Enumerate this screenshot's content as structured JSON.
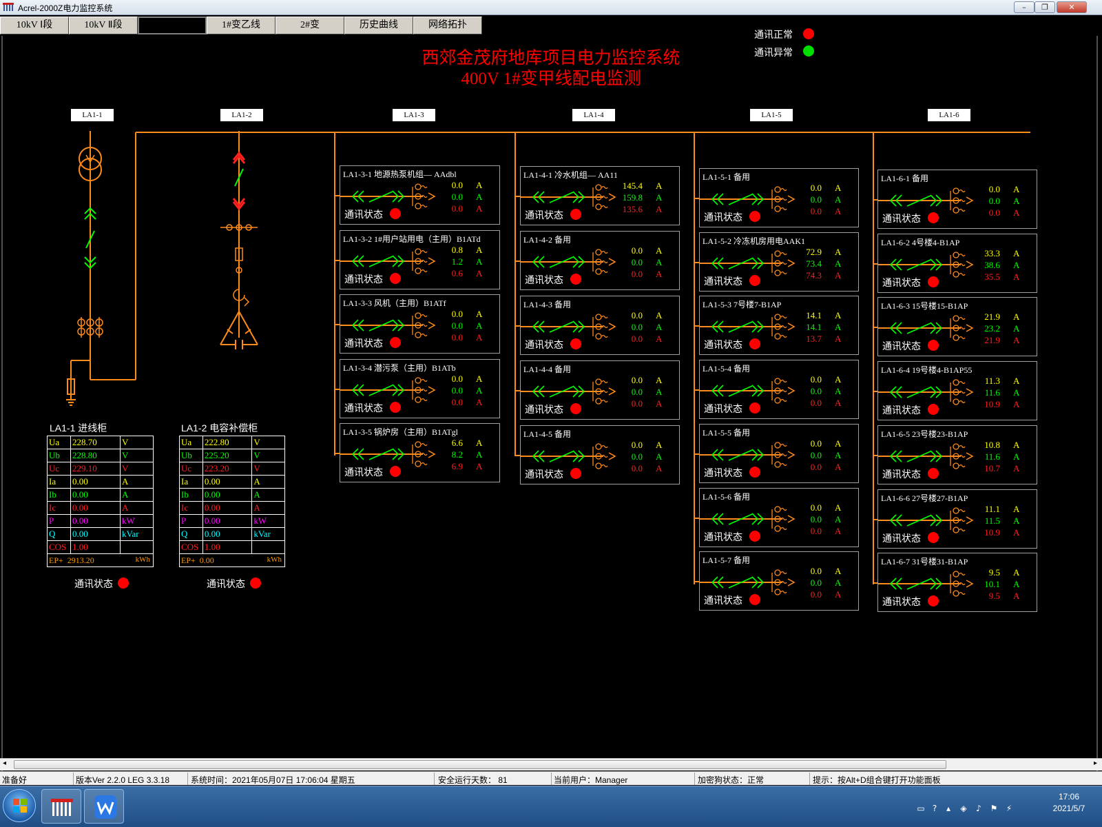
{
  "window": {
    "title": "Acrel-2000Z电力监控系统",
    "min": "–",
    "max": "❐",
    "close": "✕"
  },
  "tabs": [
    "10kV Ⅰ段",
    "10kV Ⅱ段",
    "",
    "1#变乙线",
    "2#变",
    "历史曲线",
    "网络拓扑"
  ],
  "legend": {
    "normal_label": "通讯正常",
    "abnormal_label": "通讯异常",
    "normal_color": "#ff0000",
    "abnormal_color": "#00e000"
  },
  "title": {
    "line1": "西郊金茂府地库项目电力监控系统",
    "line2": "400V 1#变甲线配电监测"
  },
  "bus_labels": [
    "LA1-1",
    "LA1-2",
    "LA1-3",
    "LA1-4",
    "LA1-5",
    "LA1-6"
  ],
  "comm_label": "通讯状态",
  "feeders": [
    [
      {
        "title": "LA1-3-1 地源热泵机组— AAdbl",
        "vals": [
          "0.0",
          "0.0",
          "0.0"
        ],
        "unit": "A"
      },
      {
        "title": "LA1-3-2 1#用户站用电（主用）B1ATd",
        "vals": [
          "0.8",
          "1.2",
          "0.6"
        ],
        "unit": "A"
      },
      {
        "title": "LA1-3-3 风机（主用）B1ATf",
        "vals": [
          "0.0",
          "0.0",
          "0.0"
        ],
        "unit": "A"
      },
      {
        "title": "LA1-3-4 潜污泵（主用）B1ATb",
        "vals": [
          "0.0",
          "0.0",
          "0.0"
        ],
        "unit": "A"
      },
      {
        "title": "LA1-3-5 锅炉房（主用）B1ATgl",
        "vals": [
          "6.6",
          "8.2",
          "6.9"
        ],
        "unit": "A"
      }
    ],
    [
      {
        "title": "LA1-4-1 冷水机组— AA11",
        "vals": [
          "145.4",
          "159.8",
          "135.6"
        ],
        "unit": "A"
      },
      {
        "title": "LA1-4-2 备用",
        "vals": [
          "0.0",
          "0.0",
          "0.0"
        ],
        "unit": "A"
      },
      {
        "title": "LA1-4-3 备用",
        "vals": [
          "0.0",
          "0.0",
          "0.0"
        ],
        "unit": "A"
      },
      {
        "title": "LA1-4-4 备用",
        "vals": [
          "0.0",
          "0.0",
          "0.0"
        ],
        "unit": "A"
      },
      {
        "title": "LA1-4-5 备用",
        "vals": [
          "0.0",
          "0.0",
          "0.0"
        ],
        "unit": "A"
      }
    ],
    [
      {
        "title": "LA1-5-1 备用",
        "vals": [
          "0.0",
          "0.0",
          "0.0"
        ],
        "unit": "A"
      },
      {
        "title": "LA1-5-2 冷冻机房用电AAK1",
        "vals": [
          "72.9",
          "73.4",
          "74.3"
        ],
        "unit": "A"
      },
      {
        "title": "LA1-5-3 7号楼7-B1AP",
        "vals": [
          "14.1",
          "14.1",
          "13.7"
        ],
        "unit": "A"
      },
      {
        "title": "LA1-5-4 备用",
        "vals": [
          "0.0",
          "0.0",
          "0.0"
        ],
        "unit": "A"
      },
      {
        "title": "LA1-5-5 备用",
        "vals": [
          "0.0",
          "0.0",
          "0.0"
        ],
        "unit": "A"
      },
      {
        "title": "LA1-5-6 备用",
        "vals": [
          "0.0",
          "0.0",
          "0.0"
        ],
        "unit": "A"
      },
      {
        "title": "LA1-5-7 备用",
        "vals": [
          "0.0",
          "0.0",
          "0.0"
        ],
        "unit": "A"
      }
    ],
    [
      {
        "title": "LA1-6-1 备用",
        "vals": [
          "0.0",
          "0.0",
          "0.0"
        ],
        "unit": "A"
      },
      {
        "title": "LA1-6-2 4号楼4-B1AP",
        "vals": [
          "33.3",
          "38.6",
          "35.5"
        ],
        "unit": "A"
      },
      {
        "title": "LA1-6-3 15号楼15-B1AP",
        "vals": [
          "21.9",
          "23.2",
          "21.9"
        ],
        "unit": "A"
      },
      {
        "title": "LA1-6-4 19号楼4-B1AP55",
        "vals": [
          "11.3",
          "11.6",
          "10.9"
        ],
        "unit": "A"
      },
      {
        "title": "LA1-6-5 23号楼23-B1AP",
        "vals": [
          "10.8",
          "11.6",
          "10.7"
        ],
        "unit": "A"
      },
      {
        "title": "LA1-6-6 27号楼27-B1AP",
        "vals": [
          "11.1",
          "11.5",
          "10.9"
        ],
        "unit": "A"
      },
      {
        "title": "LA1-6-7 31号楼31-B1AP",
        "vals": [
          "9.5",
          "10.1",
          "9.5"
        ],
        "unit": "A"
      }
    ]
  ],
  "incoming": {
    "title": "LA1-1 进线柜",
    "rows": [
      [
        "Ua",
        "228.70",
        "V"
      ],
      [
        "Ub",
        "228.80",
        "V"
      ],
      [
        "Uc",
        "229.10",
        "V"
      ],
      [
        "Ia",
        "0.00",
        "A"
      ],
      [
        "Ib",
        "0.00",
        "A"
      ],
      [
        "Ic",
        "0.00",
        "A"
      ],
      [
        "P",
        "0.00",
        "kW"
      ],
      [
        "Q",
        "0.00",
        "kVar"
      ],
      [
        "COS",
        "1.00",
        ""
      ]
    ],
    "ep": [
      "EP+",
      "2913.20",
      "kWh"
    ]
  },
  "capacitor": {
    "title": "LA1-2 电容补偿柜",
    "rows": [
      [
        "Ua",
        "222.80",
        "V"
      ],
      [
        "Ub",
        "225.20",
        "V"
      ],
      [
        "Uc",
        "223.20",
        "V"
      ],
      [
        "Ia",
        "0.00",
        "A"
      ],
      [
        "Ib",
        "0.00",
        "A"
      ],
      [
        "Ic",
        "0.00",
        "A"
      ],
      [
        "P",
        "0.00",
        "kW"
      ],
      [
        "Q",
        "0.00",
        "kVar"
      ],
      [
        "COS",
        "1.00",
        ""
      ]
    ],
    "ep": [
      "EP+",
      "0.00",
      "kWh"
    ]
  },
  "row_colors": [
    "#ffff00",
    "#00ff00",
    "#ff2020",
    "#ffff00",
    "#00ff00",
    "#ff2020",
    "#ff00ff",
    "#00ffff",
    "#ff2020"
  ],
  "statusbar": {
    "ready": "准备好",
    "version": "版本Ver 2.2.0 LEG 3.3.18",
    "systime": "系统时间：2021年05月07日  17:06:04  星期五",
    "safe_days": "安全运行天数：  81",
    "user": "当前用户：Manager",
    "dongle": "加密狗状态：正常",
    "tip": "提示：按Alt+D组合键打开功能面板"
  },
  "clock": {
    "time": "17:06",
    "date": "2021/5/7"
  },
  "colors": {
    "bus": "#ff8c1a",
    "green": "#00ff00",
    "red": "#ff0000"
  }
}
